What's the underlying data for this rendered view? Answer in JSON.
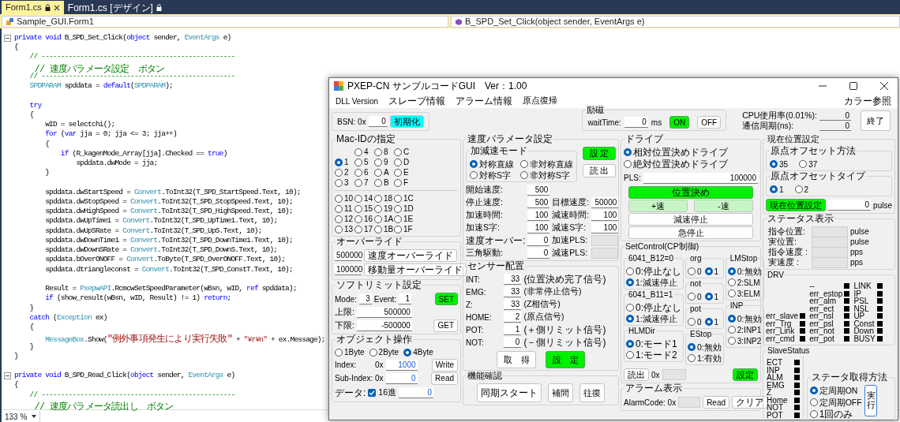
{
  "editor_tabs": [
    {
      "label": "Form1.cs",
      "selected": true
    },
    {
      "label": "Form1.cs [デザイン]",
      "selected": false
    }
  ],
  "nav": {
    "class_dropdown": "Sample_GUI.Form1",
    "member_dropdown": "B_SPD_Set_Click(object sender, EventArgs e)"
  },
  "code_lines": [
    {
      "kind": "method",
      "segments": [
        {
          "kind": "keyword",
          "text": "private void"
        },
        {
          "kind": "plain",
          "text": " B_SPD_Set_Click("
        },
        {
          "kind": "keyword",
          "text": "object"
        },
        {
          "kind": "plain",
          "text": " sender, "
        },
        {
          "kind": "type",
          "text": "EventArgs"
        },
        {
          "kind": "plain",
          "text": " e)"
        }
      ]
    },
    {
      "kind": "code",
      "segments": [
        {
          "kind": "plain",
          "text": "{"
        }
      ]
    },
    {
      "kind": "code",
      "segments": [
        {
          "kind": "comment",
          "text": "    // --------------------------------------------------"
        }
      ]
    },
    {
      "kind": "code",
      "segments": [
        {
          "kind": "comment",
          "text": "    // 速度パラメータ設定　ボタン"
        }
      ]
    },
    {
      "kind": "code",
      "segments": [
        {
          "kind": "comment",
          "text": "    // --------------------------------------------------"
        }
      ]
    },
    {
      "kind": "code",
      "segments": [
        {
          "kind": "type",
          "text": "    SPDPARAM"
        },
        {
          "kind": "plain",
          "text": " spddata = "
        },
        {
          "kind": "keyword",
          "text": "default"
        },
        {
          "kind": "plain",
          "text": "("
        },
        {
          "kind": "type",
          "text": "SPDPARAM"
        },
        {
          "kind": "plain",
          "text": ");"
        }
      ]
    },
    {
      "kind": "blank"
    },
    {
      "kind": "code",
      "segments": [
        {
          "kind": "keyword",
          "text": "    try"
        }
      ]
    },
    {
      "kind": "code",
      "segments": [
        {
          "kind": "plain",
          "text": "    {"
        }
      ]
    },
    {
      "kind": "code",
      "segments": [
        {
          "kind": "plain",
          "text": "        wID = selectchi();"
        }
      ]
    },
    {
      "kind": "code",
      "segments": [
        {
          "kind": "keyword",
          "text": "        for"
        },
        {
          "kind": "plain",
          "text": " ("
        },
        {
          "kind": "keyword",
          "text": "var"
        },
        {
          "kind": "plain",
          "text": " jja = 0; jja <= 3; jja++)"
        }
      ]
    },
    {
      "kind": "code",
      "segments": [
        {
          "kind": "plain",
          "text": "        {"
        }
      ]
    },
    {
      "kind": "code",
      "segments": [
        {
          "kind": "keyword",
          "text": "            if"
        },
        {
          "kind": "plain",
          "text": " (R_kagenMode_Array[jja].Checked == "
        },
        {
          "kind": "keyword",
          "text": "true"
        },
        {
          "kind": "plain",
          "text": ")"
        }
      ]
    },
    {
      "kind": "code",
      "segments": [
        {
          "kind": "plain",
          "text": "                spddata.dwMode = jja;"
        }
      ]
    },
    {
      "kind": "code",
      "segments": [
        {
          "kind": "plain",
          "text": "        }"
        }
      ]
    },
    {
      "kind": "blank"
    },
    {
      "kind": "code",
      "segments": [
        {
          "kind": "plain",
          "text": "        spddata.dwStartSpeed = "
        },
        {
          "kind": "type",
          "text": "Convert"
        },
        {
          "kind": "plain",
          "text": ".ToInt32(T_SPD_StartSpeed.Text, 10);"
        }
      ]
    },
    {
      "kind": "code",
      "segments": [
        {
          "kind": "plain",
          "text": "        spddata.dwStopSpeed = "
        },
        {
          "kind": "type",
          "text": "Convert"
        },
        {
          "kind": "plain",
          "text": ".ToInt32(T_SPD_StopSpeed.Text, 10);"
        }
      ]
    },
    {
      "kind": "code",
      "segments": [
        {
          "kind": "plain",
          "text": "        spddata.dwHighSpeed = "
        },
        {
          "kind": "type",
          "text": "Convert"
        },
        {
          "kind": "plain",
          "text": ".ToInt32(T_SPD_HighSpeed.Text, 10);"
        }
      ]
    },
    {
      "kind": "code",
      "segments": [
        {
          "kind": "plain",
          "text": "        spddata.dwUpTime1 = "
        },
        {
          "kind": "type",
          "text": "Convert"
        },
        {
          "kind": "plain",
          "text": ".ToInt32(T_SPD_UpTime1.Text, 10);"
        }
      ]
    },
    {
      "kind": "code",
      "segments": [
        {
          "kind": "plain",
          "text": "        spddata.dwUpSRate = "
        },
        {
          "kind": "type",
          "text": "Convert"
        },
        {
          "kind": "plain",
          "text": ".ToInt32(T_SPD_UpS.Text, 10);"
        }
      ]
    },
    {
      "kind": "code",
      "segments": [
        {
          "kind": "plain",
          "text": "        spddata.dwDownTime1 = "
        },
        {
          "kind": "type",
          "text": "Convert"
        },
        {
          "kind": "plain",
          "text": ".ToInt32(T_SPD_DownTime1.Text, 10);"
        }
      ]
    },
    {
      "kind": "code",
      "segments": [
        {
          "kind": "plain",
          "text": "        spddata.dwDownSRate = "
        },
        {
          "kind": "type",
          "text": "Convert"
        },
        {
          "kind": "plain",
          "text": ".ToInt32(T_SPD_DownS.Text, 10);"
        }
      ]
    },
    {
      "kind": "code",
      "segments": [
        {
          "kind": "plain",
          "text": "        spddata.bOverONOFF = "
        },
        {
          "kind": "type",
          "text": "Convert"
        },
        {
          "kind": "plain",
          "text": ".ToByte(T_SPD_OverONOFF.Text, 10);"
        }
      ]
    },
    {
      "kind": "code",
      "segments": [
        {
          "kind": "plain",
          "text": "        spddata.dtriangleconst = "
        },
        {
          "kind": "type",
          "text": "Convert"
        },
        {
          "kind": "plain",
          "text": ".ToInt32(T_SPD_ConstT.Text, 10);"
        }
      ]
    },
    {
      "kind": "blank"
    },
    {
      "kind": "code",
      "segments": [
        {
          "kind": "plain",
          "text": "        Result = "
        },
        {
          "kind": "type",
          "text": "PxepwAPI"
        },
        {
          "kind": "plain",
          "text": ".RcmcwSetSpeedParameter(wBsn, wID, "
        },
        {
          "kind": "keyword",
          "text": "ref"
        },
        {
          "kind": "plain",
          "text": " spddata);"
        }
      ]
    },
    {
      "kind": "code",
      "segments": [
        {
          "kind": "keyword",
          "text": "        if"
        },
        {
          "kind": "plain",
          "text": " (show_result(wBsn, wID, Result) != 1) "
        },
        {
          "kind": "keyword",
          "text": "return"
        },
        {
          "kind": "plain",
          "text": ";"
        }
      ]
    },
    {
      "kind": "code",
      "segments": [
        {
          "kind": "plain",
          "text": "    }"
        }
      ]
    },
    {
      "kind": "code",
      "segments": [
        {
          "kind": "keyword",
          "text": "    catch"
        },
        {
          "kind": "plain",
          "text": " ("
        },
        {
          "kind": "type",
          "text": "Exception"
        },
        {
          "kind": "plain",
          "text": " ex)"
        }
      ]
    },
    {
      "kind": "code",
      "segments": [
        {
          "kind": "plain",
          "text": "    {"
        }
      ]
    },
    {
      "kind": "code",
      "segments": [
        {
          "kind": "type",
          "text": "        MessageBox"
        },
        {
          "kind": "plain",
          "text": ".Show("
        },
        {
          "kind": "string",
          "text": "\"例外事項発生により実行失敗\""
        },
        {
          "kind": "plain",
          "text": " + "
        },
        {
          "kind": "string",
          "text": "\"¥r¥n\""
        },
        {
          "kind": "plain",
          "text": " + ex.Message);"
        }
      ]
    },
    {
      "kind": "code",
      "segments": [
        {
          "kind": "plain",
          "text": "    }"
        }
      ]
    },
    {
      "kind": "code",
      "segments": [
        {
          "kind": "plain",
          "text": "}"
        }
      ]
    },
    {
      "kind": "blank"
    },
    {
      "kind": "method",
      "segments": [
        {
          "kind": "keyword",
          "text": "private void"
        },
        {
          "kind": "plain",
          "text": " B_SPD_Read_Click("
        },
        {
          "kind": "keyword",
          "text": "object"
        },
        {
          "kind": "plain",
          "text": " sender, "
        },
        {
          "kind": "type",
          "text": "EventArgs"
        },
        {
          "kind": "plain",
          "text": " e)"
        }
      ]
    },
    {
      "kind": "code",
      "segments": [
        {
          "kind": "plain",
          "text": "{"
        }
      ]
    },
    {
      "kind": "code",
      "segments": [
        {
          "kind": "comment",
          "text": "    // --------------------------------------------------"
        }
      ]
    },
    {
      "kind": "code",
      "segments": [
        {
          "kind": "comment",
          "text": "    // 速度パラメータ読出し　ボタン"
        }
      ]
    }
  ],
  "zoom": "133 %",
  "form": {
    "title": "PXEP-CN サンプルコードGUI　Ver：1.00",
    "menu": [
      "DLL Version",
      "スレーブ情報",
      "アラーム情報",
      "原点復帰"
    ],
    "menu_right": "カラー参照",
    "bsn": {
      "label": "BSN: 0x",
      "value": "0",
      "button": {
        "label": "初期化",
        "kind": "cyan"
      }
    },
    "excitation": {
      "title": "励磁",
      "label": "waitTime:",
      "value": "0",
      "unit": "ms",
      "buttons": [
        {
          "label": "ON",
          "kind": "accent"
        },
        {
          "label": "OFF",
          "kind": "plain"
        }
      ]
    },
    "cpu": [
      {
        "label": "CPU使用率(0.01%):",
        "value": "0"
      },
      {
        "label": "通信周期(ns):",
        "value": "0"
      }
    ],
    "exit_button": "終了",
    "mac_id": {
      "title": "Mac-IDの指定",
      "groups": [
        [
          {
            "label": "1",
            "selected": true
          },
          {
            "label": "2",
            "selected": false
          },
          {
            "label": "3",
            "selected": false
          },
          {
            "label": "4",
            "selected": false
          },
          {
            "label": "5",
            "selected": false
          },
          {
            "label": "6",
            "selected": false
          },
          {
            "label": "7",
            "selected": false
          },
          {
            "label": "8",
            "selected": false
          },
          {
            "label": "9",
            "selected": false
          },
          {
            "label": "A",
            "selected": false
          },
          {
            "label": "B",
            "selected": false
          },
          {
            "label": "C",
            "selected": false
          },
          {
            "label": "D",
            "selected": false
          },
          {
            "label": "E",
            "selected": false
          },
          {
            "label": "F",
            "selected": false
          }
        ],
        [
          {
            "label": "10",
            "selected": false
          },
          {
            "label": "11",
            "selected": false
          },
          {
            "label": "12",
            "selected": false
          },
          {
            "label": "13",
            "selected": false
          },
          {
            "label": "14",
            "selected": false
          },
          {
            "label": "15",
            "selected": false
          },
          {
            "label": "16",
            "selected": false
          },
          {
            "label": "17",
            "selected": false
          },
          {
            "label": "18",
            "selected": false
          },
          {
            "label": "19",
            "selected": false
          },
          {
            "label": "1A",
            "selected": false
          },
          {
            "label": "1B",
            "selected": false
          },
          {
            "label": "1C",
            "selected": false
          },
          {
            "label": "1D",
            "selected": false
          },
          {
            "label": "1E",
            "selected": false
          },
          {
            "label": "1F",
            "selected": false
          }
        ]
      ]
    },
    "speed": {
      "title": "速度パラメータ設定",
      "mode": {
        "title": "加減速モード",
        "options": [
          {
            "label": "対称直線",
            "selected": true
          },
          {
            "label": "非対称直線",
            "selected": false
          },
          {
            "label": "対称S字",
            "selected": false
          },
          {
            "label": "非対称S字",
            "selected": false
          }
        ]
      },
      "buttons": [
        {
          "label": "設 定",
          "kind": "accent"
        },
        {
          "label": "読 出",
          "kind": "plain"
        }
      ],
      "left_fields": [
        {
          "label": "開始速度:",
          "value": "500"
        },
        {
          "label": "停止速度:",
          "value": "500"
        },
        {
          "label": "加速時間:",
          "value": "100"
        },
        {
          "label": "加速S字:",
          "value": "100"
        },
        {
          "label": "速度オーバー:",
          "value": "0"
        },
        {
          "label": "三角駆動:",
          "value": "0"
        }
      ],
      "right_fields": [
        {
          "label": "目標速度:",
          "value": "50000",
          "disabled": false
        },
        {
          "label": "減速時間:",
          "value": "100",
          "disabled": false
        },
        {
          "label": "減速S字:",
          "value": "100",
          "disabled": false
        },
        {
          "label": "加速PLS:",
          "disabled": true
        },
        {
          "label": "減速PLS:",
          "disabled": true
        }
      ]
    },
    "drive": {
      "title": "ドライブ",
      "options": [
        {
          "label": "相対位置決めドライブ",
          "selected": true
        },
        {
          "label": "絶対位置決めドライブ",
          "selected": false
        }
      ],
      "pls_label": "PLS:",
      "pls_value": "100000",
      "buttons": [
        {
          "label": "位置決め",
          "kind": "accent"
        },
        {
          "label": "+速",
          "kind": "light"
        },
        {
          "label": "-速",
          "kind": "light"
        },
        {
          "label": "減速停止",
          "kind": "plain"
        },
        {
          "label": "急停止",
          "kind": "plain"
        }
      ]
    },
    "position_set": {
      "title": "現在位置設定",
      "groups": [
        {
          "title": "原点オフセット方法",
          "options": [
            {
              "label": "35",
              "selected": true
            },
            {
              "label": "37",
              "selected": false
            }
          ]
        },
        {
          "title": "原点オフセットタイプ",
          "options": [
            {
              "label": "1",
              "selected": true
            },
            {
              "label": "2",
              "selected": false
            }
          ]
        }
      ],
      "button": "現在位置設定",
      "value": "0",
      "unit": "pulse"
    },
    "status": {
      "title": "ステータス表示",
      "rows": [
        {
          "label": "指令位置:",
          "unit": "pulse"
        },
        {
          "label": "実位置:",
          "unit": "pulse"
        },
        {
          "label": "指令速度 :",
          "unit": "pps"
        },
        {
          "label": "実速度 :",
          "unit": "pps"
        }
      ]
    },
    "override": {
      "title": "オーバーライド",
      "rows": [
        {
          "value": "500000",
          "button": "速度オーバーライド"
        },
        {
          "value": "100000",
          "button": "移動量オーバーライド"
        }
      ]
    },
    "soft_limit": {
      "title": "ソフトリミット設定",
      "mode_label": "Mode:",
      "mode": "3",
      "event_label": "Event:",
      "event": "1",
      "set_button": "SET",
      "upper_label": "上限:",
      "upper": "500000",
      "lower_label": "下限:",
      "lower": "-500000",
      "get_button": "GET"
    },
    "object": {
      "title": "オブジェクト操作",
      "sizes": [
        {
          "label": "1Byte",
          "selected": false
        },
        {
          "label": "2Byte",
          "selected": false
        },
        {
          "label": "4Byte",
          "selected": true
        }
      ],
      "index_label": "Index:",
      "index_prefix": "0x",
      "index": "1000",
      "write_button": "Write",
      "sub_label": "Sub-Index:",
      "sub_prefix": "0x",
      "sub": "0",
      "read_button": "Read",
      "data_label": "データ:",
      "hex_checked": true,
      "hex_label": "16進",
      "data": "0"
    },
    "sensors": {
      "title": "センサー配置",
      "rows": [
        {
          "label": "INT:",
          "value": "33",
          "note": "(位置決め完了信号)"
        },
        {
          "label": "EMG:",
          "value": "33",
          "note": "(非常停止信号)"
        },
        {
          "label": "Z:",
          "value": "33",
          "note": "(Z相信号)"
        },
        {
          "label": "HOME:",
          "value": "2",
          "note": "(原点信号)"
        },
        {
          "label": "POT:",
          "value": "1",
          "note": "(＋側リミット信号)"
        },
        {
          "label": "NOT:",
          "value": "0",
          "note": "(－側リミット信号)"
        }
      ],
      "buttons": [
        {
          "label": "取　得",
          "kind": "plain"
        },
        {
          "label": "設　定",
          "kind": "accent"
        }
      ]
    },
    "function_check": {
      "title": "機能確認",
      "buttons": [
        "同期スタート",
        "補間",
        "往復"
      ]
    },
    "set_control": {
      "title": "SetControl(CP制御)",
      "columns": [
        [
          {
            "title": "6041_B12=0",
            "kind": "stacked",
            "options": [
              {
                "label": "0:停止なし",
                "selected": false
              },
              {
                "label": "1:減速停止",
                "selected": true
              }
            ]
          },
          {
            "title": "6041_B11=1",
            "kind": "stacked",
            "options": [
              {
                "label": "0:停止なし",
                "selected": false
              },
              {
                "label": "1:減速停止",
                "selected": true
              }
            ]
          },
          {
            "title": "HLMDir",
            "kind": "stacked",
            "options": [
              {
                "label": "0:モード1",
                "selected": true
              },
              {
                "label": "1:モード2",
                "selected": false
              }
            ]
          }
        ],
        [
          {
            "title": "org",
            "kind": "inline",
            "options": [
              {
                "label": "0",
                "selected": false
              },
              {
                "label": "1",
                "selected": true
              }
            ]
          },
          {
            "title": "not",
            "kind": "inline",
            "options": [
              {
                "label": "0",
                "selected": false
              },
              {
                "label": "1",
                "selected": true
              }
            ]
          },
          {
            "title": "pot",
            "kind": "inline",
            "options": [
              {
                "label": "0",
                "selected": false
              },
              {
                "label": "1",
                "selected": true
              }
            ]
          },
          {
            "title": "EStop",
            "kind": "stacked",
            "options": [
              {
                "label": "0:無効",
                "selected": true
              },
              {
                "label": "1:有効",
                "selected": false
              }
            ]
          }
        ],
        [
          {
            "title": "LMStop",
            "kind": "stacked",
            "options": [
              {
                "label": "0:無効",
                "selected": true
              },
              {
                "label": "2:SLM",
                "selected": false
              },
              {
                "label": "3:ELM",
                "selected": false
              }
            ]
          },
          {
            "title": "INP",
            "kind": "stacked",
            "options": [
              {
                "label": "0:無効",
                "selected": true
              },
              {
                "label": "2:INP1",
                "selected": false
              },
              {
                "label": "3:INP2",
                "selected": false
              }
            ]
          }
        ]
      ],
      "read_button": "読出",
      "prefix": "0x",
      "set_button": "設定"
    },
    "alarm": {
      "title": "アラーム表示",
      "label": "AlarmCode: 0x",
      "buttons": [
        "Read",
        "クリア"
      ]
    },
    "drv": {
      "title": "DRV",
      "columns": [
        [
          "err_slave",
          "err_Trg",
          "err_Link",
          "err_cmd"
        ],
        [
          "--",
          "err_estop",
          "err_alm",
          "err_ect",
          "err_nsl",
          "err_psl",
          "err_not",
          "err_pot"
        ],
        [
          "LINK",
          "IP",
          "PSL",
          "NSL",
          "UP",
          "Const",
          "Down",
          "BUSY"
        ]
      ]
    },
    "slave_status": {
      "title": "SlaveStatus",
      "items": [
        "ECT",
        "INP",
        "ALM",
        "EMG",
        "Z",
        "Home",
        "NOT",
        "POT"
      ]
    },
    "acquire": {
      "title": "ステータ取得方法",
      "options": [
        {
          "label": "定周期ON",
          "selected": true
        },
        {
          "label": "定周期OFF",
          "selected": false
        },
        {
          "label": "1回のみ",
          "selected": false
        }
      ],
      "button": "実行"
    }
  }
}
